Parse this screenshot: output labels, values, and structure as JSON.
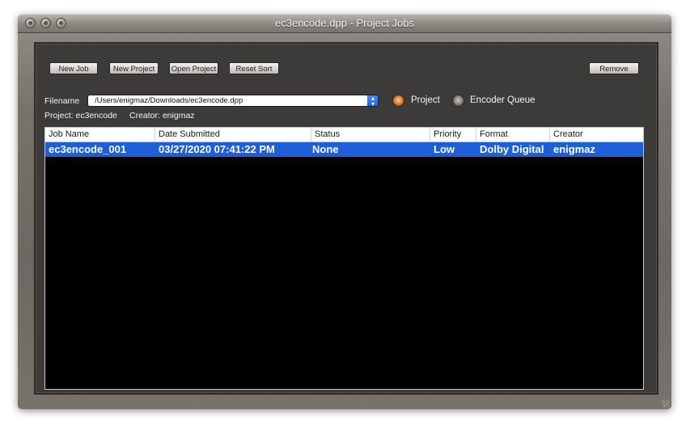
{
  "window": {
    "title": "ec3encode.dpp - Project Jobs"
  },
  "toolbar": {
    "new_job": "New Job",
    "new_project": "New Project",
    "open_project": "Open Project",
    "reset_sort": "Reset Sort",
    "remove": "Remove"
  },
  "file": {
    "label": "Filename",
    "path": "/Users/enigmaz/Downloads/ec3encode.dpp"
  },
  "mode": {
    "project_label": "Project",
    "queue_label": "Encoder Queue",
    "selected": "Project"
  },
  "info": {
    "project": "Project: ec3encode",
    "creator": "Creator: enigmaz"
  },
  "table": {
    "headers": [
      "Job Name",
      "Date Submitted",
      "Status",
      "Priority",
      "Format",
      "Creator"
    ],
    "rows": [
      [
        "ec3encode_001",
        "03/27/2020 07:41:22 PM",
        "None",
        "Low",
        "Dolby Digital",
        "enigmaz"
      ]
    ]
  },
  "colors": {
    "selection": "#1c5fd6",
    "table_bg": "#000000",
    "panel_bg": "#3d3b39",
    "radio_on": "#f08a32"
  },
  "icons": {
    "stepper": "up-down-chevron-icon",
    "window_controls": [
      "close-icon",
      "minimize-icon",
      "zoom-icon"
    ]
  }
}
